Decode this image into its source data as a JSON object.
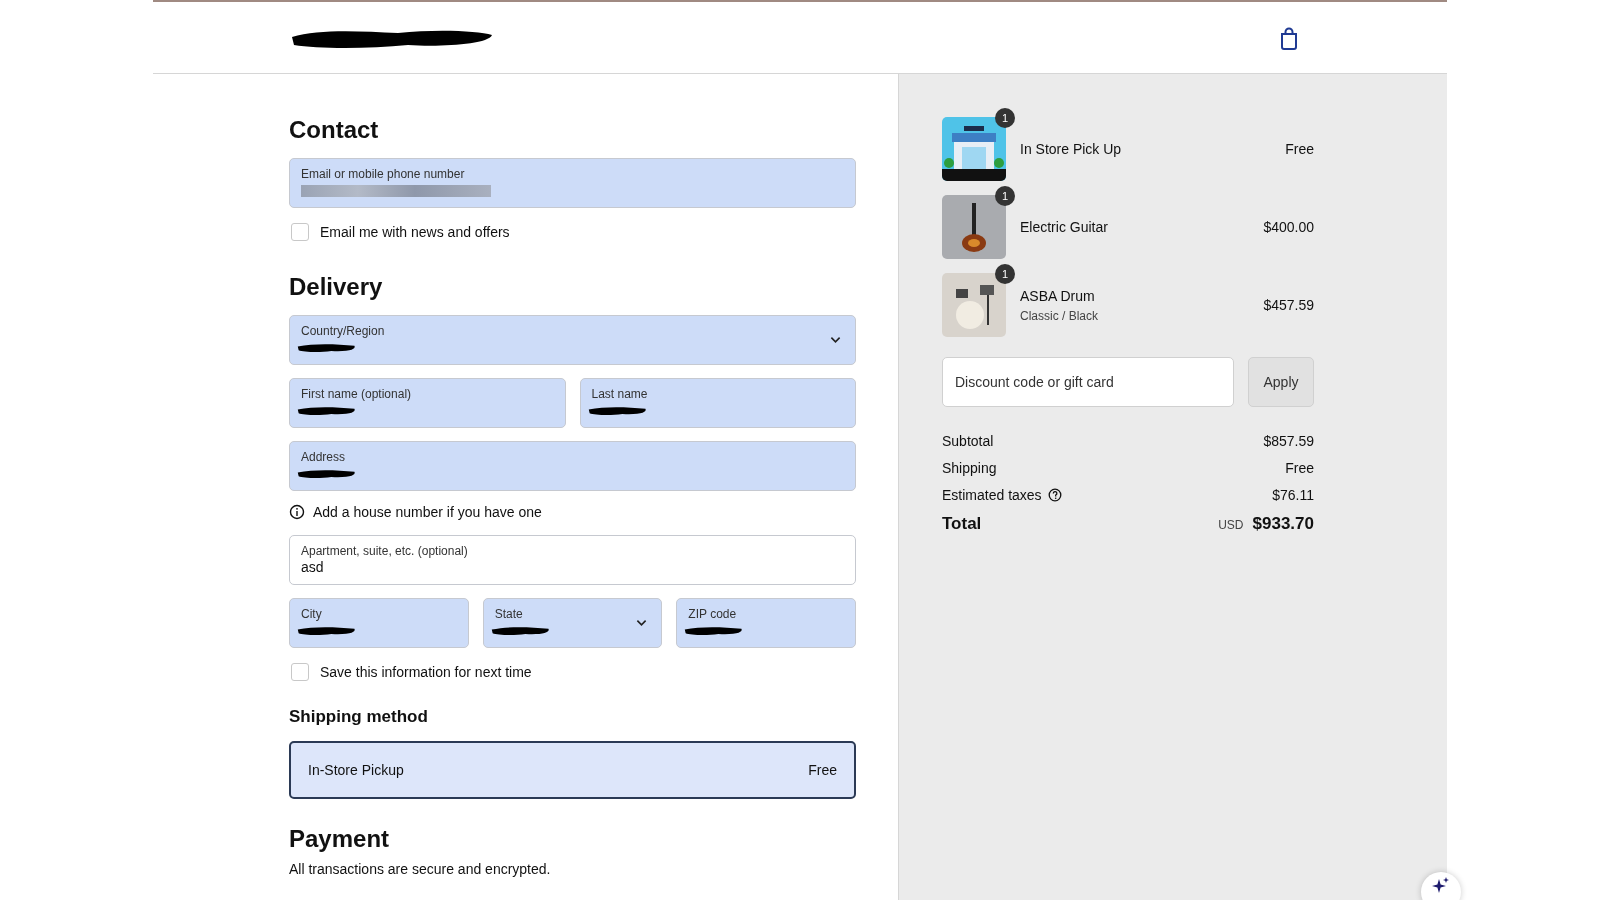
{
  "header": {
    "logo_redacted": true
  },
  "contact": {
    "title": "Contact",
    "email": {
      "label": "Email or mobile phone number",
      "autofilled": true,
      "redacted": true
    },
    "newsletter": {
      "label": "Email me with news and offers",
      "checked": false
    }
  },
  "delivery": {
    "title": "Delivery",
    "rows": [
      [
        {
          "kind": "select",
          "label": "Country/Region",
          "autofilled": true,
          "redacted": true
        }
      ],
      [
        {
          "kind": "text",
          "label": "First name (optional)",
          "autofilled": true,
          "redacted": true
        },
        {
          "kind": "text",
          "label": "Last name",
          "autofilled": true,
          "redacted": true
        }
      ],
      [
        {
          "kind": "text",
          "label": "Address",
          "autofilled": true,
          "redacted": true
        }
      ],
      [
        {
          "kind": "hint",
          "label": "Add a house number if you have one"
        }
      ],
      [
        {
          "kind": "text",
          "label": "Apartment, suite, etc. (optional)",
          "value": "asd",
          "autofilled": false,
          "redacted": false
        }
      ],
      [
        {
          "kind": "text",
          "label": "City",
          "autofilled": true,
          "redacted": true
        },
        {
          "kind": "select",
          "label": "State",
          "autofilled": true,
          "redacted": true
        },
        {
          "kind": "text",
          "label": "ZIP code",
          "autofilled": true,
          "redacted": true
        }
      ]
    ],
    "save": {
      "label": "Save this information for next time",
      "checked": false
    }
  },
  "shipping_method": {
    "title": "Shipping method",
    "options": [
      {
        "name": "In-Store Pickup",
        "price": "Free",
        "selected": true
      }
    ]
  },
  "payment": {
    "title": "Payment",
    "note": "All transactions are secure and encrypted."
  },
  "summary": {
    "items": [
      {
        "kind": "store",
        "name": "In Store Pick Up",
        "quantity": "1",
        "price": "Free"
      },
      {
        "kind": "guitar",
        "name": "Electric Guitar",
        "quantity": "1",
        "price": "$400.00"
      },
      {
        "kind": "drum",
        "name": "ASBA Drum",
        "variant": "Classic / Black",
        "quantity": "1",
        "price": "$457.59"
      }
    ],
    "discount": {
      "placeholder": "Discount code or gift card",
      "button": "Apply"
    },
    "lines": [
      {
        "label": "Subtotal",
        "value": "$857.59",
        "info": false
      },
      {
        "label": "Shipping",
        "value": "Free",
        "info": false
      },
      {
        "label": "Estimated taxes",
        "value": "$76.11",
        "info": true
      }
    ],
    "total": {
      "label": "Total",
      "currency": "USD",
      "value": "$933.70"
    }
  }
}
